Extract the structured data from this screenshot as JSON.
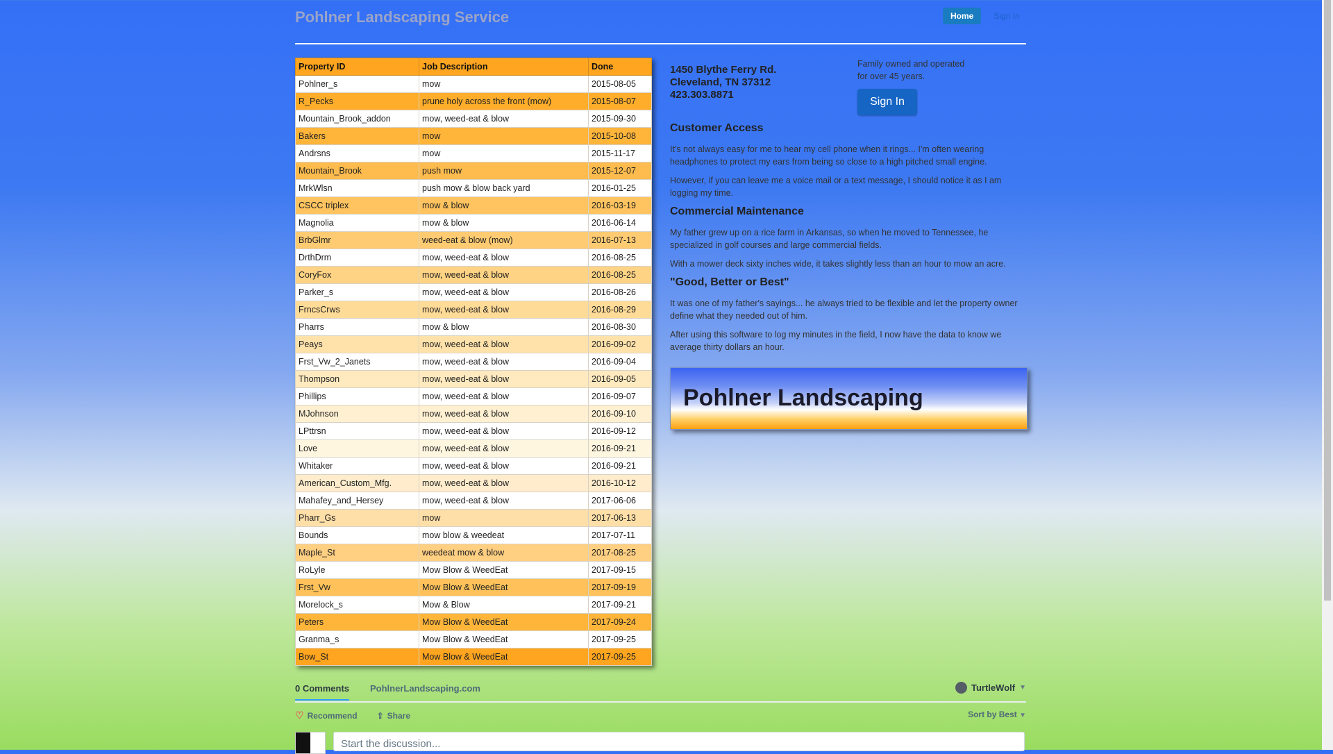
{
  "header": {
    "title": "Pohlner Landscaping Service",
    "nav": {
      "home": "Home",
      "sign_in": "Sign In"
    }
  },
  "table": {
    "columns": [
      "Property ID",
      "Job Description",
      "Done"
    ],
    "rows": [
      [
        "Pohlner_s",
        "mow",
        "2015-08-05"
      ],
      [
        "R_Pecks",
        "prune holy across the front (mow)",
        "2015-08-07"
      ],
      [
        "Mountain_Brook_addon",
        "mow, weed-eat & blow",
        "2015-09-30"
      ],
      [
        "Bakers",
        "mow",
        "2015-10-08"
      ],
      [
        "Andrsns",
        "mow",
        "2015-11-17"
      ],
      [
        "Mountain_Brook",
        "push mow",
        "2015-12-07"
      ],
      [
        "MrkWlsn",
        "push mow & blow back yard",
        "2016-01-25"
      ],
      [
        "CSCC triplex",
        "mow & blow",
        "2016-03-19"
      ],
      [
        "Magnolia",
        "mow & blow",
        "2016-06-14"
      ],
      [
        "BrbGlmr",
        "weed-eat & blow (mow)",
        "2016-07-13"
      ],
      [
        "DrthDrm",
        "mow, weed-eat & blow",
        "2016-08-25"
      ],
      [
        "CoryFox",
        "mow, weed-eat & blow",
        "2016-08-25"
      ],
      [
        "Parker_s",
        "mow, weed-eat & blow",
        "2016-08-26"
      ],
      [
        "FrncsCrws",
        "mow, weed-eat & blow",
        "2016-08-29"
      ],
      [
        "Pharrs",
        "mow & blow",
        "2016-08-30"
      ],
      [
        "Peays",
        "mow, weed-eat & blow",
        "2016-09-02"
      ],
      [
        "Frst_Vw_2_Janets",
        "mow, weed-eat & blow",
        "2016-09-04"
      ],
      [
        "Thompson",
        "mow, weed-eat & blow",
        "2016-09-05"
      ],
      [
        "Phillips",
        "mow, weed-eat & blow",
        "2016-09-07"
      ],
      [
        "MJohnson",
        "mow, weed-eat & blow",
        "2016-09-10"
      ],
      [
        "LPttrsn",
        "mow, weed-eat & blow",
        "2016-09-12"
      ],
      [
        "Love",
        "mow, weed-eat & blow",
        "2016-09-21"
      ],
      [
        "Whitaker",
        "mow, weed-eat & blow",
        "2016-09-21"
      ],
      [
        "American_Custom_Mfg.",
        "mow, weed-eat & blow",
        "2016-10-12"
      ],
      [
        "Mahafey_and_Hersey",
        "mow, weed-eat & blow",
        "2017-06-06"
      ],
      [
        "Pharr_Gs",
        "mow",
        "2017-06-13"
      ],
      [
        "Bounds",
        "mow blow & weedeat",
        "2017-07-11"
      ],
      [
        "Maple_St",
        "weedeat mow & blow",
        "2017-08-25"
      ],
      [
        "RoLyle",
        "Mow Blow & WeedEat",
        "2017-09-15"
      ],
      [
        "Frst_Vw",
        "Mow Blow & WeedEat",
        "2017-09-19"
      ],
      [
        "Morelock_s",
        "Mow & Blow",
        "2017-09-21"
      ],
      [
        "Peters",
        "Mow Blow & WeedEat",
        "2017-09-24"
      ],
      [
        "Granma_s",
        "Mow Blow & WeedEat",
        "2017-09-25"
      ],
      [
        "Bow_St",
        "Mow Blow & WeedEat",
        "2017-09-25"
      ]
    ],
    "row_colors": [
      "#ffffff",
      "#ffad2a",
      "#ffffff",
      "#ffb43a",
      "#ffffff",
      "#ffbc4e",
      "#ffffff",
      "#ffc45f",
      "#ffffff",
      "#ffcb72",
      "#ffffff",
      "#ffd384",
      "#ffffff",
      "#ffdb98",
      "#ffffff",
      "#ffe2aa",
      "#ffffff",
      "#ffe9be",
      "#ffffff",
      "#fff0d2",
      "#ffffff",
      "#fff6e0",
      "#ffffff",
      "#ffeccc",
      "#ffffff",
      "#ffdfa8",
      "#ffffff",
      "#ffcf82",
      "#ffffff",
      "#ffc25a",
      "#ffffff",
      "#ffb53a",
      "#ffffff",
      "#ffa51f"
    ]
  },
  "contact": {
    "address1": "1450 Blythe Ferry Rd.",
    "address2": "Cleveland, TN 37312",
    "phone": "423.303.8871"
  },
  "tagline": {
    "line1": "Family owned and operated",
    "line2": "for over 45 years."
  },
  "sign_in_button": "Sign In",
  "sections": [
    {
      "heading": "Customer Access",
      "paragraphs": [
        "It's not always easy for me to hear my cell phone when it rings... I'm often wearing headphones to protect my ears from being so close to a high pitched small engine.",
        "However, if you can leave me a voice mail or a text message, I should notice it as I am logging my time."
      ]
    },
    {
      "heading": "Commercial Maintenance",
      "paragraphs": [
        "My father grew up on a rice farm in Arkansas, so when he moved to Tennessee, he specialized in golf courses and large commercial fields.",
        "With a mower deck sixty inches wide, it takes slightly less than an hour to mow an acre."
      ]
    },
    {
      "heading": "\"Good, Better or Best\"",
      "paragraphs": [
        "It was one of my father's sayings... he always tried to be flexible and let the property owner define what they needed out of him.",
        "After using this software to log my minutes in the field, I now have the data to know we average thirty dollars an hour."
      ]
    }
  ],
  "banner": {
    "title": "Pohlner Landscaping"
  },
  "comments": {
    "count_label": "0 Comments",
    "site_label": "PohlnerLandscaping.com",
    "user": "TurtleWolf",
    "recommend": "Recommend",
    "share": "Share",
    "sort": "Sort by Best",
    "placeholder": "Start the discussion..."
  },
  "icons": [
    "chevron-down-icon",
    "heart-icon",
    "share-icon",
    "user-avatar-icon"
  ]
}
